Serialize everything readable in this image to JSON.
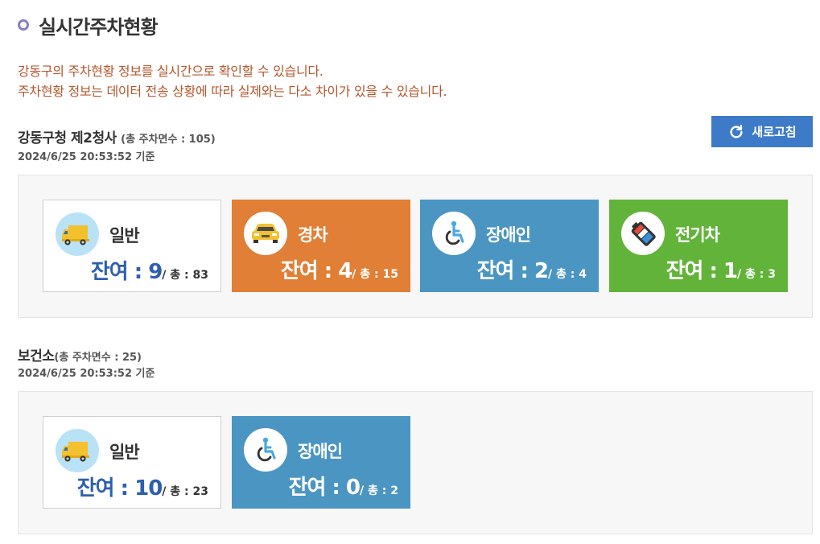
{
  "page": {
    "title": "실시간주차현황"
  },
  "notice": {
    "line1": "강동구의 주차현황 정보를 실시간으로 확인할 수 있습니다.",
    "line2": "주차현황 정보는 데이터 전송 상황에 따라 실제와는 다소 차이가 있을 수 있습니다."
  },
  "refresh_label": "새로고침",
  "lots": [
    {
      "name": "강동구청 제2청사",
      "total_text": "(총 주차면수 : 105)",
      "updated": "2024/6/25 20:53:52 기준",
      "cards": [
        {
          "category": "일반",
          "icon": "truck-icon",
          "remain_text": "잔여 : 9",
          "total_prefix": "/ 총 : ",
          "total": "83"
        },
        {
          "category": "경차",
          "icon": "car-icon",
          "remain_text": "잔여 : 4",
          "total_prefix": "/ 총 : ",
          "total": "15"
        },
        {
          "category": "장애인",
          "icon": "wheelchair-icon",
          "remain_text": "잔여 : 2",
          "total_prefix": "/ 총 : ",
          "total": "4"
        },
        {
          "category": "전기차",
          "icon": "battery-icon",
          "remain_text": "잔여 : 1",
          "total_prefix": "/ 총 : ",
          "total": "3"
        }
      ]
    },
    {
      "name": "보건소",
      "total_text": "(총 주차면수 : 25)",
      "updated": "2024/6/25 20:53:52 기준",
      "cards": [
        {
          "category": "일반",
          "icon": "truck-icon",
          "remain_text": "잔여 : 10",
          "total_prefix": "/ 총 : ",
          "total": "23"
        },
        {
          "category": "장애인",
          "icon": "wheelchair-icon",
          "remain_text": "잔여 : 0",
          "total_prefix": "/ 총 : ",
          "total": "2"
        }
      ]
    }
  ],
  "colors": {
    "general_card": "#ffffff",
    "compact_card": "#e07f35",
    "disabled_card": "#4b95c3",
    "ev_card": "#62b33a",
    "notice_text": "#b5562b",
    "refresh_button": "#3d7bc8"
  }
}
